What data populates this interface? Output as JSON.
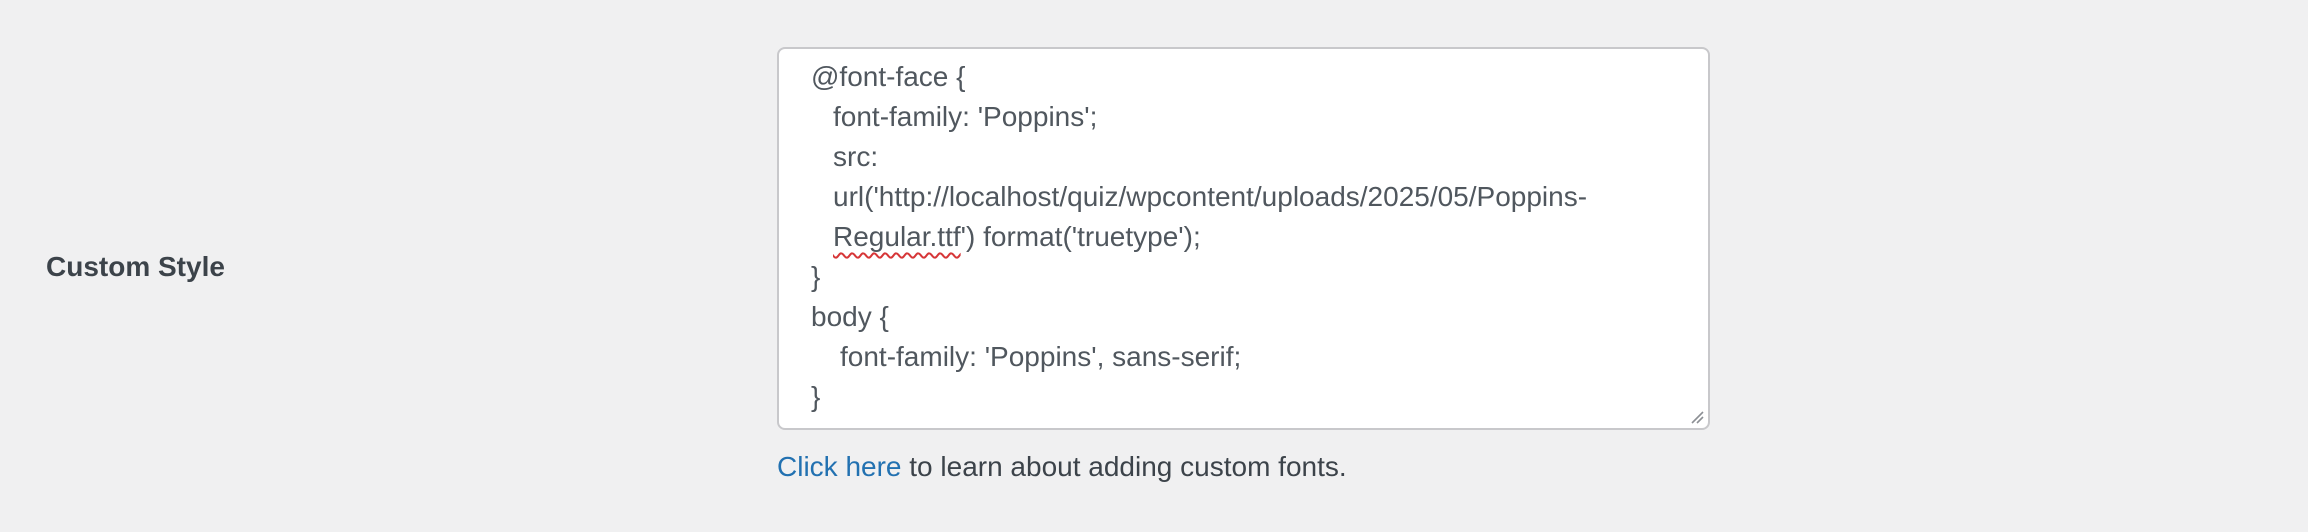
{
  "field": {
    "label": "Custom Style"
  },
  "editor": {
    "line_1": "@font-face {",
    "line_2": "font-family: 'Poppins';",
    "line_3": "src:",
    "line_4": "url('http://localhost/quiz/wpcontent/uploads/2025/05/Poppins-",
    "line_5_misspelled": "Regular.ttf",
    "line_5_rest": "') format('truetype');",
    "line_6": "}",
    "line_7": "body {",
    "line_8": "font-family: 'Poppins', sans-serif;",
    "line_9": "}"
  },
  "help": {
    "link_text": "Click here",
    "text": " to learn about adding custom fonts."
  },
  "icons": {
    "resize_handle": "resize-handle-icon"
  },
  "colors": {
    "background": "#f0f0f1",
    "link": "#2271b1",
    "text": "#3c434a",
    "code_text": "#50575e",
    "spellcheck_underline": "#d63638",
    "border": "#c8c8cb"
  }
}
